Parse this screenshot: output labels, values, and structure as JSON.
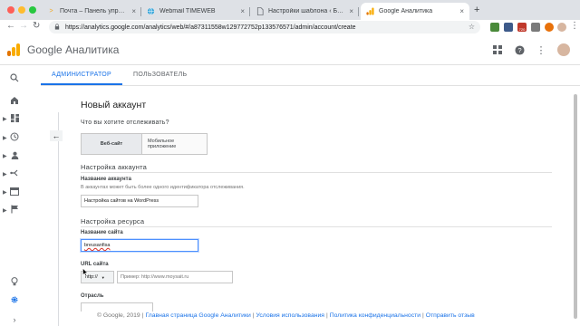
{
  "browser": {
    "tabs": [
      {
        "label": "Почта – Панель управления «…",
        "icon": "mail-arrow-icon",
        "active": false
      },
      {
        "label": "Webmail TIMEWEB",
        "icon": "globe-icon",
        "active": false
      },
      {
        "label": "Настройки шаблона ‹ Блог А…",
        "icon": "page-icon",
        "active": false
      },
      {
        "label": "Google Аналитика",
        "icon": "analytics-icon",
        "active": true
      }
    ],
    "url": "https://analytics.google.com/analytics/web/#/a87311558w129772752p133576571/admin/account/create",
    "ext_badge": "720"
  },
  "app": {
    "title": "Google Аналитика",
    "colors": {
      "accent": "#1a73e8",
      "logo_orange": "#f9ab00",
      "logo_dark": "#e37400"
    }
  },
  "admin_tabs": [
    "АДМИНИСТРАТОР",
    "ПОЛЬЗОВАТЕЛЬ"
  ],
  "form": {
    "title": "Новый аккаунт",
    "question": "Что вы хотите отслеживать?",
    "options": [
      "Веб-сайт",
      "Мобильное приложение"
    ],
    "selected_option": "Веб-сайт",
    "account_section": "Настройка аккаунта",
    "account_name_label": "Название аккаунта",
    "account_name_hint": "В аккаунтах может быть более одного идентификатора отслеживания.",
    "account_name_value": "Настройка сайтов на WordPress",
    "property_section": "Настройка ресурса",
    "site_name_label": "Название сайта",
    "site_name_value": "breusanfisa",
    "url_label": "URL сайта",
    "protocol_value": "http://",
    "url_placeholder": "Пример: http://www.moysait.ru",
    "industry_label": "Отрасль"
  },
  "footer": {
    "copyright": "© Google, 2019",
    "links": [
      "Главная страница Google Аналитики",
      "Условия использования",
      "Политика конфиденциальности",
      "Отправить отзыв"
    ]
  }
}
